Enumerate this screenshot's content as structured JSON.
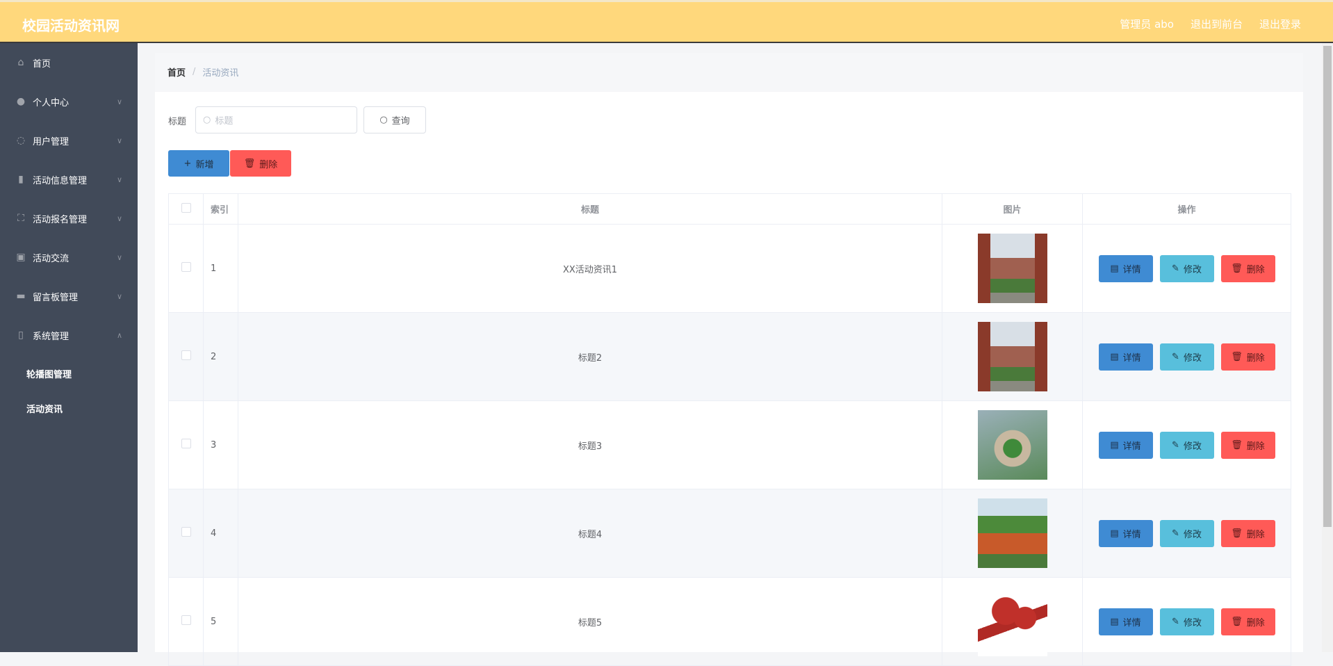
{
  "header": {
    "title": "校园活动资讯网",
    "user": "管理员 abo",
    "to_front": "退出到前台",
    "logout": "退出登录"
  },
  "sidebar": {
    "items": [
      {
        "label": "首页",
        "icon": "home-icon"
      },
      {
        "label": "个人中心",
        "icon": "user-icon"
      },
      {
        "label": "用户管理",
        "icon": "compass-icon"
      },
      {
        "label": "活动信息管理",
        "icon": "bar-chart-icon"
      },
      {
        "label": "活动报名管理",
        "icon": "fullscreen-icon"
      },
      {
        "label": "活动交流",
        "icon": "clipboard-icon"
      },
      {
        "label": "留言板管理",
        "icon": "monitor-icon"
      },
      {
        "label": "系统管理",
        "icon": "microphone-icon"
      }
    ],
    "subitems": [
      {
        "label": "轮播图管理"
      },
      {
        "label": "活动资讯"
      }
    ]
  },
  "breadcrumb": {
    "home": "首页",
    "current": "活动资讯"
  },
  "search": {
    "label": "标题",
    "placeholder": "标题",
    "query": "查询"
  },
  "toolbar": {
    "add": "新增",
    "delete": "删除"
  },
  "table": {
    "headers": {
      "index": "索引",
      "title": "标题",
      "image": "图片",
      "actions": "操作"
    },
    "rows": [
      {
        "index": "1",
        "title": "XX活动资讯1"
      },
      {
        "index": "2",
        "title": "标题2"
      },
      {
        "index": "3",
        "title": "标题3"
      },
      {
        "index": "4",
        "title": "标题4"
      },
      {
        "index": "5",
        "title": "标题5"
      }
    ],
    "actions": {
      "detail": "详情",
      "edit": "修改",
      "delete": "删除"
    }
  }
}
